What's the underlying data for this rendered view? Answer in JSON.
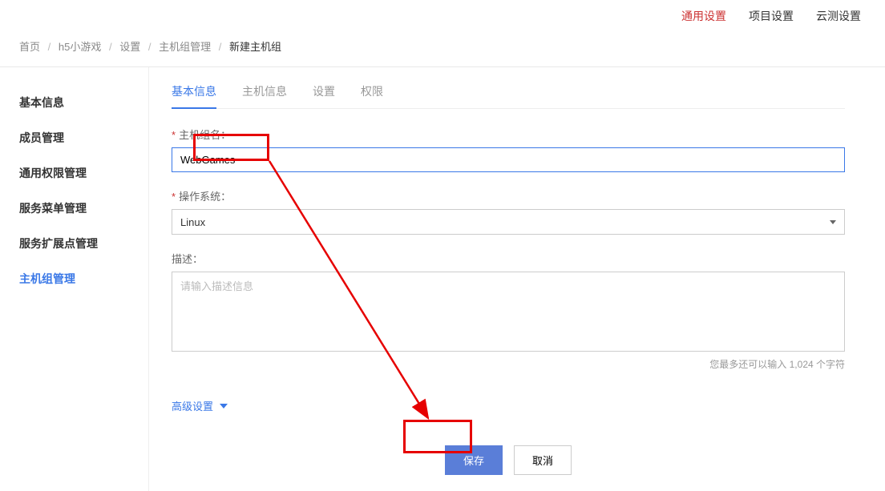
{
  "topnav": {
    "general": "通用设置",
    "project": "项目设置",
    "cloud": "云测设置"
  },
  "breadcrumb": {
    "items": [
      "首页",
      "h5小游戏",
      "设置",
      "主机组管理",
      "新建主机组"
    ]
  },
  "sidebar": {
    "items": [
      {
        "label": "基本信息"
      },
      {
        "label": "成员管理"
      },
      {
        "label": "通用权限管理"
      },
      {
        "label": "服务菜单管理"
      },
      {
        "label": "服务扩展点管理"
      },
      {
        "label": "主机组管理"
      }
    ]
  },
  "tabs": {
    "items": [
      {
        "label": "基本信息"
      },
      {
        "label": "主机信息"
      },
      {
        "label": "设置"
      },
      {
        "label": "权限"
      }
    ]
  },
  "form": {
    "hostgroup_label": "主机组名：",
    "hostgroup_value": "WebGames",
    "os_label": "操作系统：",
    "os_value": "Linux",
    "desc_label": "描述：",
    "desc_placeholder": "请输入描述信息",
    "char_hint": "您最多还可以输入 1,024 个字符",
    "advanced_label": "高级设置",
    "save_label": "保存",
    "cancel_label": "取消"
  }
}
